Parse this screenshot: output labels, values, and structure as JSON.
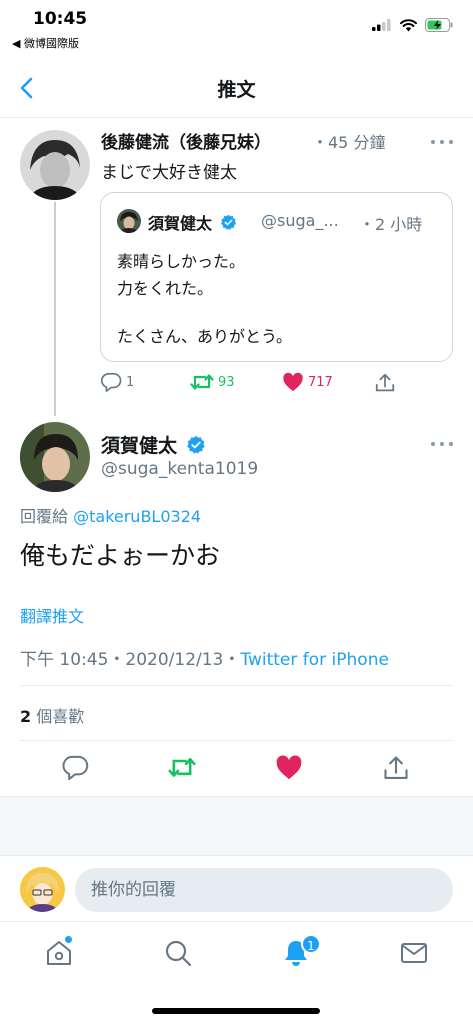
{
  "status_bar": {
    "time": "10:45",
    "back_app": "◀ 微博國際版"
  },
  "nav": {
    "title": "推文",
    "back_icon": "chevron-left-icon"
  },
  "parent_tweet": {
    "author_name": "後藤健流（後藤兄妹）",
    "time": "・45 分鐘",
    "text": "まじで大好き健太",
    "quoted": {
      "author_name": "須賀健太",
      "handle": "@suga_...",
      "time": "・2 小時",
      "lines": [
        "素晴らしかった。",
        "力をくれた。",
        "",
        "たくさん、ありがとう。"
      ]
    },
    "actions": {
      "reply_count": "1",
      "retweet_count": "93",
      "like_count": "717"
    }
  },
  "main_tweet": {
    "author_name": "須賀健太",
    "handle": "@suga_kenta1019",
    "reply_prefix": "回覆給",
    "reply_to": "@takeruBL0324",
    "text": "俺もだよぉーかお",
    "translate_label": "翻譯推文",
    "timestamp": "下午 10:45・2020/12/13・",
    "source": "Twitter for iPhone",
    "likes_count": "2",
    "likes_label": " 個喜歡"
  },
  "reply_bar": {
    "placeholder": "推你的回覆"
  },
  "tab_bar": {
    "notification_badge": "1"
  },
  "colors": {
    "accent": "#1da1f2",
    "retweet": "#17bf63",
    "like": "#e0245e",
    "muted": "#657786"
  }
}
